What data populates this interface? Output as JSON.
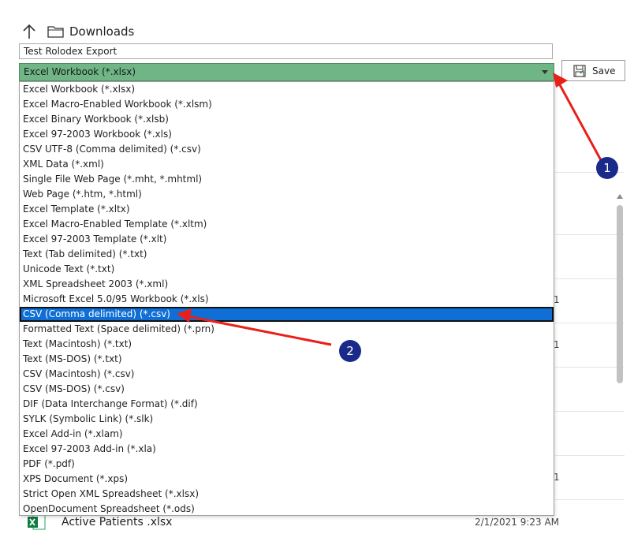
{
  "nav": {
    "location": "Downloads",
    "up_icon": "arrow-up-icon",
    "folder_icon": "folder-icon"
  },
  "filename": {
    "value": "Test Rolodex Export"
  },
  "filetype": {
    "selected": "Excel Workbook (*.xlsx)",
    "accent": "#6fb585"
  },
  "save": {
    "label": "Save"
  },
  "options": [
    "Excel Workbook (*.xlsx)",
    "Excel Macro-Enabled Workbook (*.xlsm)",
    "Excel Binary Workbook (*.xlsb)",
    "Excel 97-2003 Workbook (*.xls)",
    "CSV UTF-8 (Comma delimited) (*.csv)",
    "XML Data (*.xml)",
    "Single File Web Page (*.mht, *.mhtml)",
    "Web Page (*.htm, *.html)",
    "Excel Template (*.xltx)",
    "Excel Macro-Enabled Template (*.xltm)",
    "Excel 97-2003 Template (*.xlt)",
    "Text (Tab delimited) (*.txt)",
    "Unicode Text (*.txt)",
    "XML Spreadsheet 2003 (*.xml)",
    "Microsoft Excel 5.0/95 Workbook (*.xls)",
    "CSV (Comma delimited) (*.csv)",
    "Formatted Text (Space delimited) (*.prn)",
    "Text (Macintosh) (*.txt)",
    "Text (MS-DOS) (*.txt)",
    "CSV (Macintosh) (*.csv)",
    "CSV (MS-DOS) (*.csv)",
    "DIF (Data Interchange Format) (*.dif)",
    "SYLK (Symbolic Link) (*.slk)",
    "Excel Add-in (*.xlam)",
    "Excel 97-2003 Add-in (*.xla)",
    "PDF (*.pdf)",
    "XPS Document (*.xps)",
    "Strict Open XML Spreadsheet (*.xlsx)",
    "OpenDocument Spreadsheet (*.ods)"
  ],
  "selected_index": 15,
  "bg_fragments": [
    "1",
    "1",
    "1"
  ],
  "bottom_file": {
    "name": "Active Patients .xlsx",
    "date": "2/1/2021 9:23 AM",
    "icon": "excel-file-icon"
  },
  "annotations": {
    "badge1": "1",
    "badge2": "2",
    "arrow_color": "#e8201a",
    "badge_color": "#1a2a8a"
  }
}
